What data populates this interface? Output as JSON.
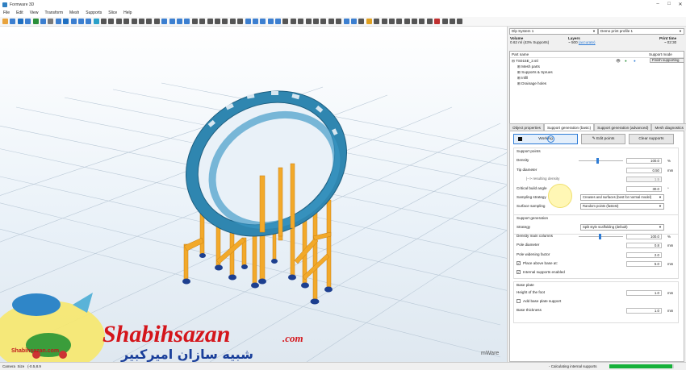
{
  "app": {
    "title": "Formware 3D",
    "win_min": "–",
    "win_max": "□",
    "win_close": "✕"
  },
  "menu": [
    "File",
    "Edit",
    "View",
    "Transform",
    "Mesh",
    "Supports",
    "Slice",
    "Help"
  ],
  "toolbar_icon_colors": [
    "#e8a33d",
    "#3c7fd0",
    "#1f6fc1",
    "#3c7fd0",
    "#2a8f3a",
    "#3c7fd0",
    "#7a7a7a",
    "#3c7fd0",
    "#1f6fc1",
    "#3c7fd0",
    "#3c7fd0",
    "#3c7fd0",
    "#2aa0c8",
    "#555",
    "#555",
    "#555",
    "#555",
    "#555",
    "#555",
    "#555",
    "#555",
    "#3c7fd0",
    "#3c7fd0",
    "#3c7fd0",
    "#3c7fd0",
    "#555",
    "#555",
    "#555",
    "#555",
    "#555",
    "#555",
    "#555",
    "#3c7fd0",
    "#3c7fd0",
    "#3c7fd0",
    "#3c7fd0",
    "#3c7fd0",
    "#555",
    "#555",
    "#555",
    "#555",
    "#555",
    "#555",
    "#555",
    "#555",
    "#3c7fd0",
    "#3c7fd0",
    "#555",
    "#e0a020",
    "#555",
    "#555",
    "#555",
    "#555",
    "#555",
    "#555",
    "#555",
    "#555",
    "#c03030",
    "#555",
    "#555",
    "#555"
  ],
  "printer": {
    "machine": "Dlp System 1",
    "profile": "Demo print profile 1"
  },
  "stats": {
    "volume_label": "Volume",
    "volume_value": "0.62 ml (43% Supports)",
    "layers_label": "Layers",
    "layers_value": "~ 500",
    "layers_note": "(accurate)",
    "print_time_label": "Print time",
    "print_time_value": "~ 02:30"
  },
  "parts": {
    "col_name": "Part name",
    "col_mode": "Support mode",
    "root": "TS015E_2.stl",
    "root_mode": "Finish supporting",
    "children": [
      "Mesh parts",
      "Supports & Sprues",
      "Infill",
      "Drainage holes"
    ]
  },
  "tabs": [
    "Object properties",
    "Support generation (basic)",
    "Support generation (advanced)",
    "Mesh diagnostics"
  ],
  "buttons": {
    "working": "Working",
    "edit_points": "Edit points",
    "clear_supports": "Clear supports"
  },
  "support_points": {
    "title": "Support points",
    "density_label": "Density",
    "density_value": "100.0",
    "density_unit": "%",
    "density_slider_frac": 0.4,
    "tip_label": "Tip diameter",
    "tip_value": "0.50",
    "tip_unit": "mm",
    "resulting_label": "|--> resulting density",
    "resulting_value": "1.5",
    "angle_label": "Critical build angle",
    "angle_value": "30.0",
    "angle_unit": "°",
    "sampling_label": "Sampling strategy",
    "sampling_value": "Creases and surfaces (best for normal model)",
    "surface_label": "Surface sampling",
    "surface_value": "Random points (fastest)"
  },
  "support_generation": {
    "title": "Support generation",
    "strategy_label": "Strategy",
    "strategy_value": "Split style scaffolding (default)",
    "density_label": "Density main columns",
    "density_value": "100.0",
    "density_unit": "%",
    "density_slider_frac": 0.45,
    "pole_label": "Pole diameter",
    "pole_value": "0.8",
    "pole_unit": "mm",
    "widening_label": "Pole widening factor",
    "widening_value": "2.0",
    "place_above_label": "Place above base at:",
    "place_above_value": "5.0",
    "place_above_unit": "mm",
    "internal_label": "Internal supports enabled"
  },
  "base_plate": {
    "title": "Base plate",
    "height_label": "Height of the foot",
    "height_value": "1.0",
    "height_unit": "mm",
    "add_label": "Add base plate support",
    "thickness_label": "Base thickness",
    "thickness_value": "1.0",
    "thickness_unit": "mm"
  },
  "viewport": {
    "watermark_brand": "mWare",
    "logo_line1": "Shabihsazan",
    "logo_line2": ".com",
    "logo_fa": "شبیه سازان امیرکبیر",
    "logo_small": "Shabihsazan.com"
  },
  "status": {
    "camera": "Camera",
    "cam_value": "Size",
    "coords": "(-0.5,8.9",
    "message": "- Calculating internal supports",
    "progress_frac": 0.98
  },
  "colors": {
    "model": "#2f86b0",
    "supports": "#f2a92a",
    "feet": "#1d3f8f",
    "accent": "#2e7cd6"
  }
}
